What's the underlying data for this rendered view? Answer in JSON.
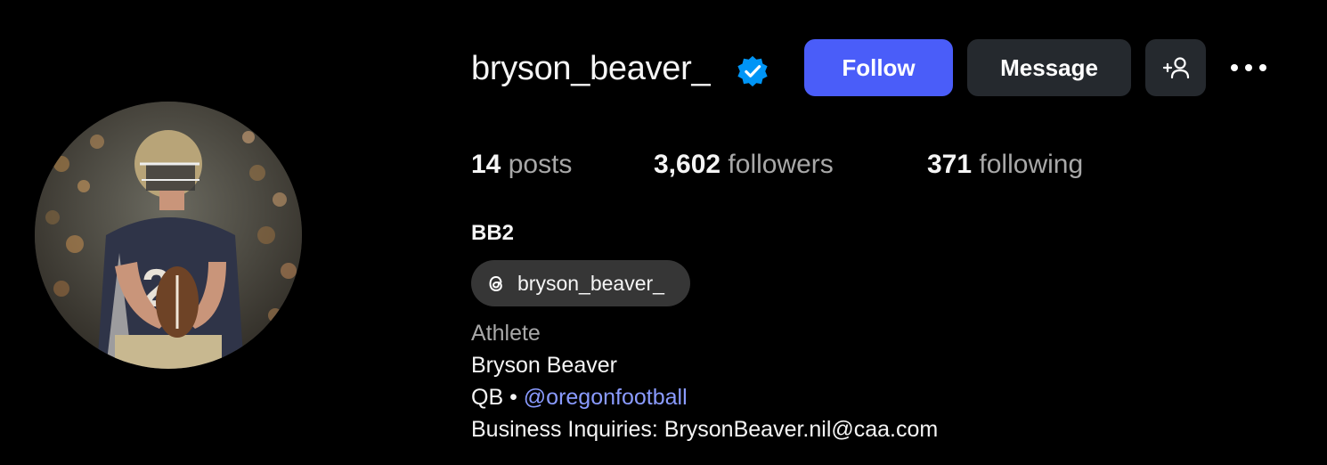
{
  "profile": {
    "username": "bryson_beaver_",
    "verified": true,
    "display_name": "BB2",
    "category": "Athlete",
    "bio": {
      "name_line": "Bryson Beaver",
      "role_prefix": "QB",
      "separator": "•",
      "team_link": "@oregonfootball",
      "business_line": "Business Inquiries: BrysonBeaver.nil@caa.com"
    },
    "threads_handle": "bryson_beaver_"
  },
  "actions": {
    "follow_label": "Follow",
    "message_label": "Message",
    "suggest_icon": "add-person-icon",
    "more_icon": "more-horizontal-icon"
  },
  "stats": {
    "posts": {
      "count": "14",
      "label": "posts"
    },
    "followers": {
      "count": "3,602",
      "label": "followers"
    },
    "following": {
      "count": "371",
      "label": "following"
    }
  },
  "colors": {
    "background": "#000000",
    "follow_button": "#4a5df9",
    "secondary_button": "#25292e",
    "verified_badge": "#0095f6",
    "link": "#8a9bff",
    "muted_text": "#a8a8a8"
  }
}
